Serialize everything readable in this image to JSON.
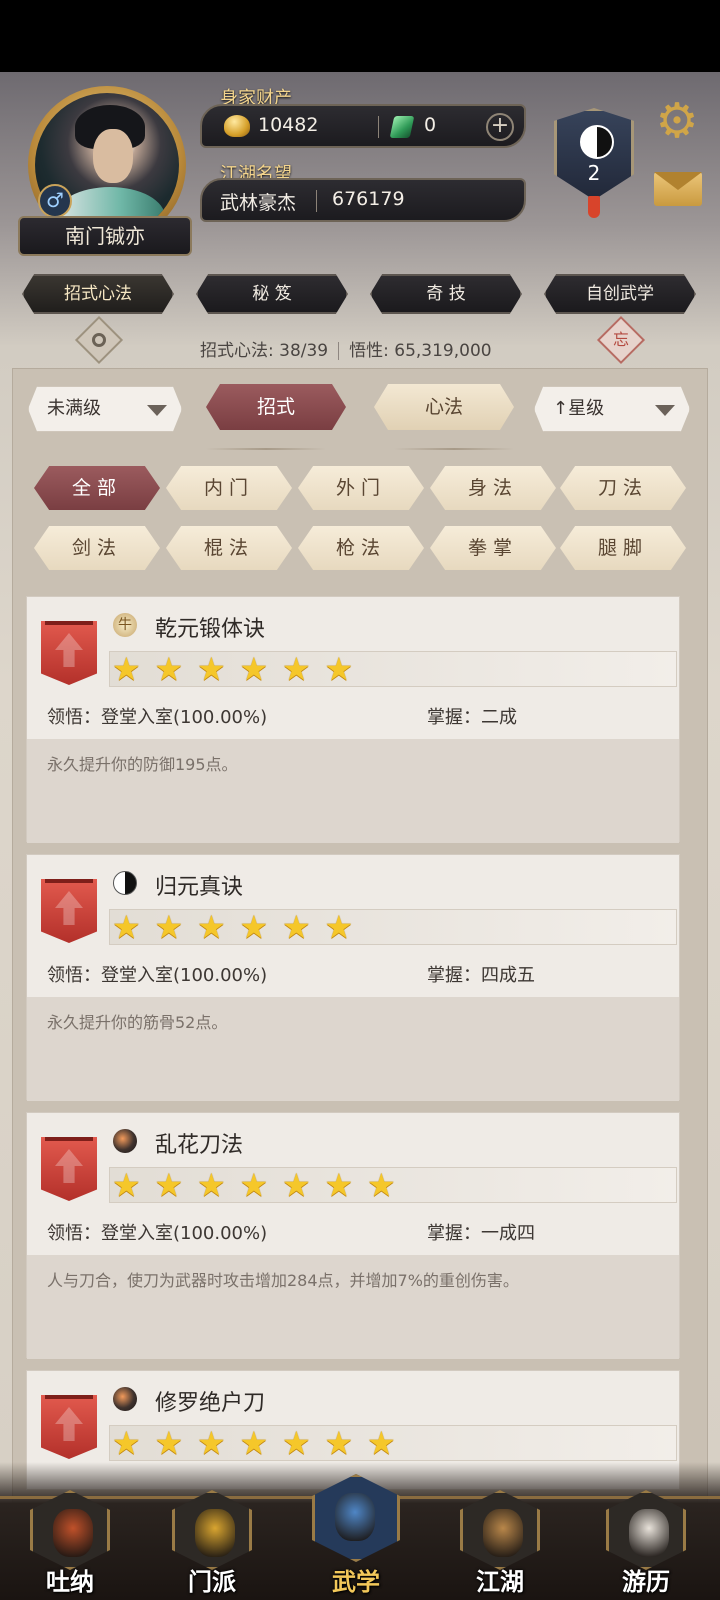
{
  "player": {
    "name": "南门铖亦",
    "gender_symbol": "♂",
    "wealth_label": "身家财产",
    "gold": "10482",
    "jade": "0",
    "reputation_label": "江湖名望",
    "title": "武林豪杰",
    "reputation_value": "676179",
    "rank_level": "2"
  },
  "top_tabs": [
    "招式心法",
    "秘 笈",
    "奇 技",
    "自创武学"
  ],
  "stats": {
    "skills_text": "招式心法: 38/39",
    "insight_text": "悟性: 65,319,000"
  },
  "seal_char": "忘",
  "filters": {
    "level_dropdown": "未满级",
    "sort_dropdown": "↑星级",
    "mode_tabs": [
      "招式",
      "心法"
    ],
    "categories_row1": [
      "全部",
      "内门",
      "外门",
      "身法",
      "刀法"
    ],
    "categories_row2": [
      "剑法",
      "棍法",
      "枪法",
      "拳掌",
      "腿脚"
    ]
  },
  "skills": [
    {
      "name": "乾元锻体诀",
      "icon": "ox-icon",
      "stars": 6,
      "comprehension": "领悟：登堂入室(100.00%)",
      "mastery": "掌握：二成",
      "description": "永久提升你的防御195点。"
    },
    {
      "name": "归元真诀",
      "icon": "yinyang-icon",
      "stars": 6,
      "comprehension": "领悟：登堂入室(100.00%)",
      "mastery": "掌握：四成五",
      "description": "永久提升你的筋骨52点。"
    },
    {
      "name": "乱花刀法",
      "icon": "blade-icon",
      "stars": 7,
      "comprehension": "领悟：登堂入室(100.00%)",
      "mastery": "掌握：一成四",
      "description": "人与刀合，使刀为武器时攻击增加284点，并增加7%的重创伤害。"
    },
    {
      "name": "修罗绝户刀",
      "icon": "blade-icon",
      "stars": 7
    }
  ],
  "bottom_nav": [
    {
      "label": "吐纳",
      "icon": "monk-icon",
      "color": "#c0512a"
    },
    {
      "label": "门派",
      "icon": "banner-flag-icon",
      "color": "#d9a530"
    },
    {
      "label": "武学",
      "icon": "scroll-book-icon",
      "color": "#4f86c6",
      "active": true
    },
    {
      "label": "江湖",
      "icon": "straw-hat-icon",
      "color": "#b9874a"
    },
    {
      "label": "游历",
      "icon": "horse-icon",
      "color": "#e8e2da"
    }
  ]
}
